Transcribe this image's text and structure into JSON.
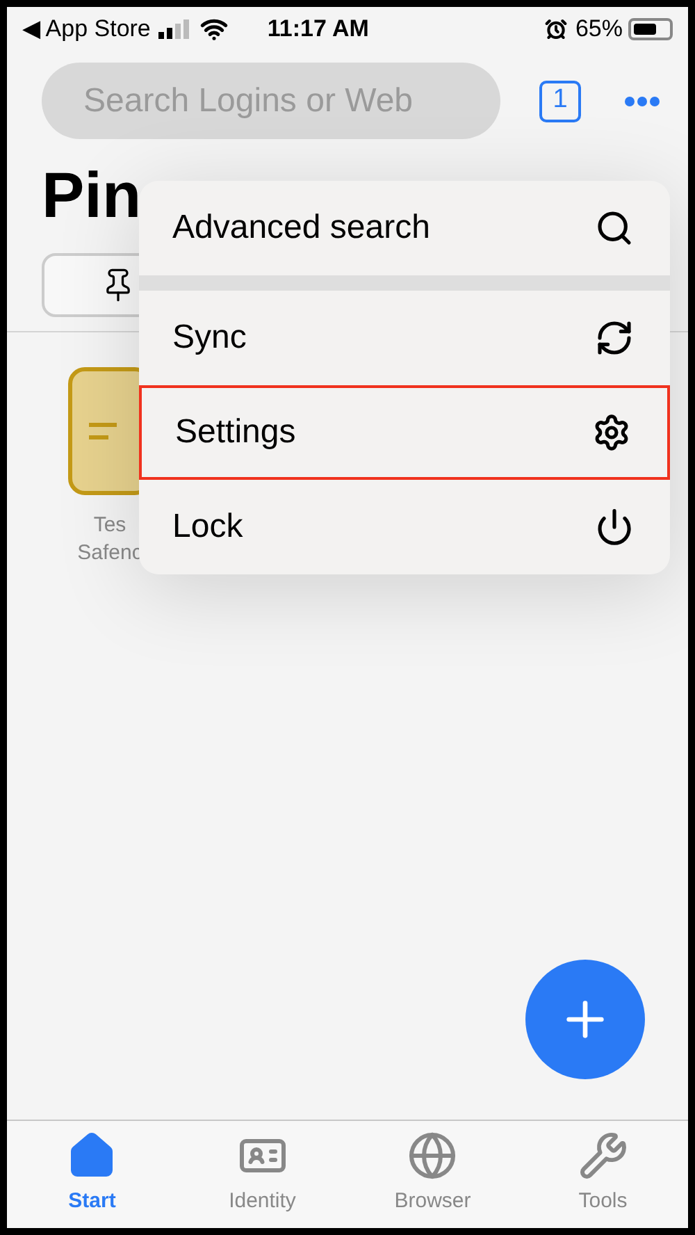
{
  "status_bar": {
    "back_label": "◀ App Store",
    "time": "11:17 AM",
    "battery": "65%"
  },
  "search": {
    "placeholder": "Search Logins or Web"
  },
  "tab_count": "1",
  "title": "Pin",
  "pinned_item": {
    "label_line_1": "Tes",
    "label_line_2": "Safenc"
  },
  "menu": [
    {
      "label": "Advanced search",
      "highlighted": false
    },
    {
      "label": "Sync",
      "highlighted": false
    },
    {
      "label": "Settings",
      "highlighted": true
    },
    {
      "label": "Lock",
      "highlighted": false
    }
  ],
  "tab_bar": [
    {
      "label": "Start",
      "selected": true
    },
    {
      "label": "Identity",
      "selected": false
    },
    {
      "label": "Browser",
      "selected": false
    },
    {
      "label": "Tools",
      "selected": false
    }
  ]
}
